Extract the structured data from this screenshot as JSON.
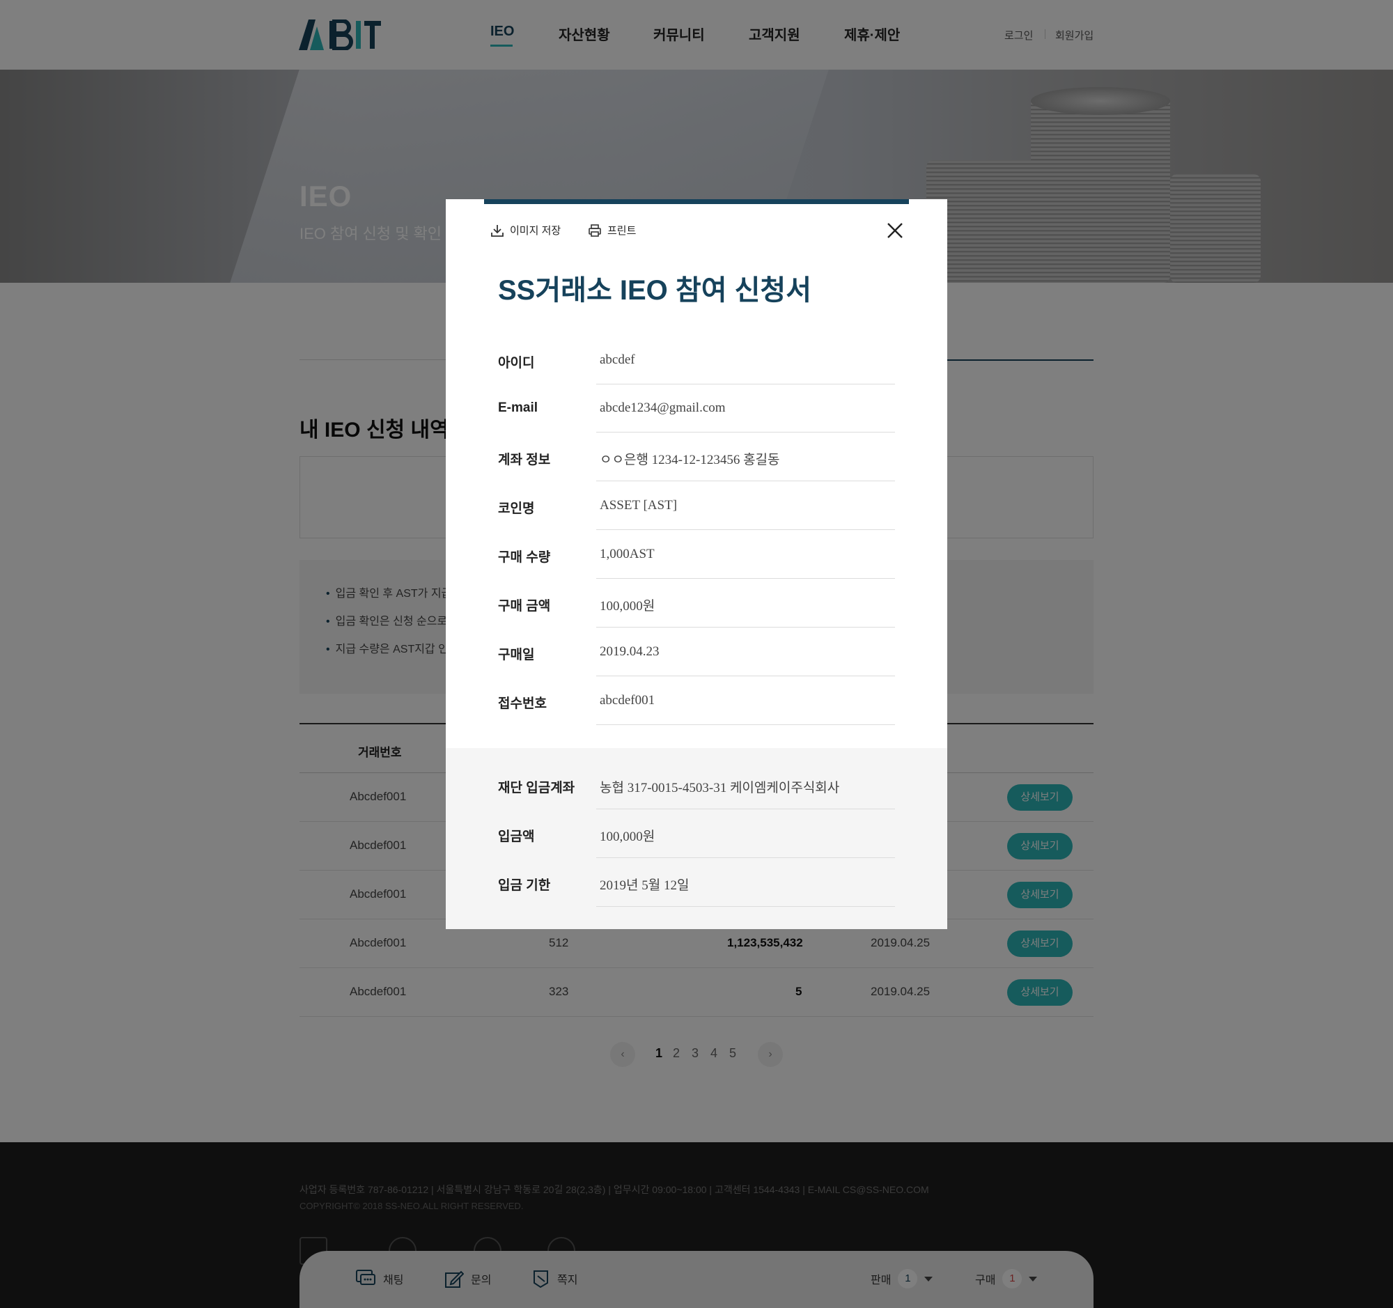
{
  "header": {
    "logo_text": "ABIT",
    "nav": [
      "IEO",
      "자산현황",
      "커뮤니티",
      "고객지원",
      "제휴·제안"
    ],
    "active_nav": "IEO",
    "login": "로그인",
    "signup": "회원가입"
  },
  "hero": {
    "title": "IEO",
    "subtitle": "IEO 참여 신청 및 확인 안내"
  },
  "main": {
    "section_title": "내 IEO 신청 내역",
    "notices": [
      "입금 확인 후 AST가 지급",
      "입금 확인은 신청 순으로",
      "지급 수량은 AST지갑 인"
    ],
    "table": {
      "headers": [
        "거래번호"
      ],
      "detail_label": "상세보기",
      "rows": [
        {
          "id": "Abcdef001",
          "qty": "",
          "amount": "",
          "date": ""
        },
        {
          "id": "Abcdef001",
          "qty": "",
          "amount": "",
          "date": ""
        },
        {
          "id": "Abcdef001",
          "qty": "",
          "amount": "",
          "date": ""
        },
        {
          "id": "Abcdef001",
          "qty": "512",
          "amount": "1,123,535,432",
          "date": "2019.04.25"
        },
        {
          "id": "Abcdef001",
          "qty": "323",
          "amount": "5",
          "date": "2019.04.25"
        }
      ]
    },
    "pagination": {
      "prev": "‹",
      "next": "›",
      "pages": [
        "1",
        "2",
        "3",
        "4",
        "5"
      ],
      "current": "1"
    }
  },
  "footer": {
    "line1": "사업자 등록번호 787-86-01212   |   서울특별시 강남구 학동로 20길 28(2,3층)   |   업무시간 09:00~18:00   |   고객센터 1544-4343   |   E-MAIL CS@SS-NEO.COM",
    "copyright": "COPYRIGHT© 2018 SS-NEO.ALL RIGHT RESERVED."
  },
  "bottom_bar": {
    "chat": "채팅",
    "inquiry": "문의",
    "message": "쪽지",
    "sell_label": "판매",
    "sell_count": "1",
    "buy_label": "구매",
    "buy_count": "1"
  },
  "modal": {
    "save_image": "이미지 저장",
    "print": "프린트",
    "title": "SS거래소 IEO 참여 신청서",
    "fields": [
      {
        "label": "아이디",
        "value": "abcdef"
      },
      {
        "label": "E-mail",
        "value": "abcde1234@gmail.com"
      },
      {
        "label": "계좌 정보",
        "value": "ㅇㅇ은행 1234-12-123456 홍길동"
      },
      {
        "label": "코인명",
        "value": "ASSET [AST]"
      },
      {
        "label": "구매 수량",
        "value": "1,000AST"
      },
      {
        "label": "구매 금액",
        "value": "100,000원"
      },
      {
        "label": "구매일",
        "value": "2019.04.23"
      },
      {
        "label": "접수번호",
        "value": "abcdef001"
      }
    ],
    "deposit_fields": [
      {
        "label": "재단 입금계좌",
        "value": "농협 317-0015-4503-31 케이엠케이주식회사"
      },
      {
        "label": "입금액",
        "value": "100,000원"
      },
      {
        "label": "입금 기한",
        "value": "2019년 5월 12일"
      }
    ]
  },
  "colors": {
    "brand_navy": "#16425b",
    "accent_teal": "#2cb7b9",
    "footer_bg": "#1f1f1f"
  }
}
